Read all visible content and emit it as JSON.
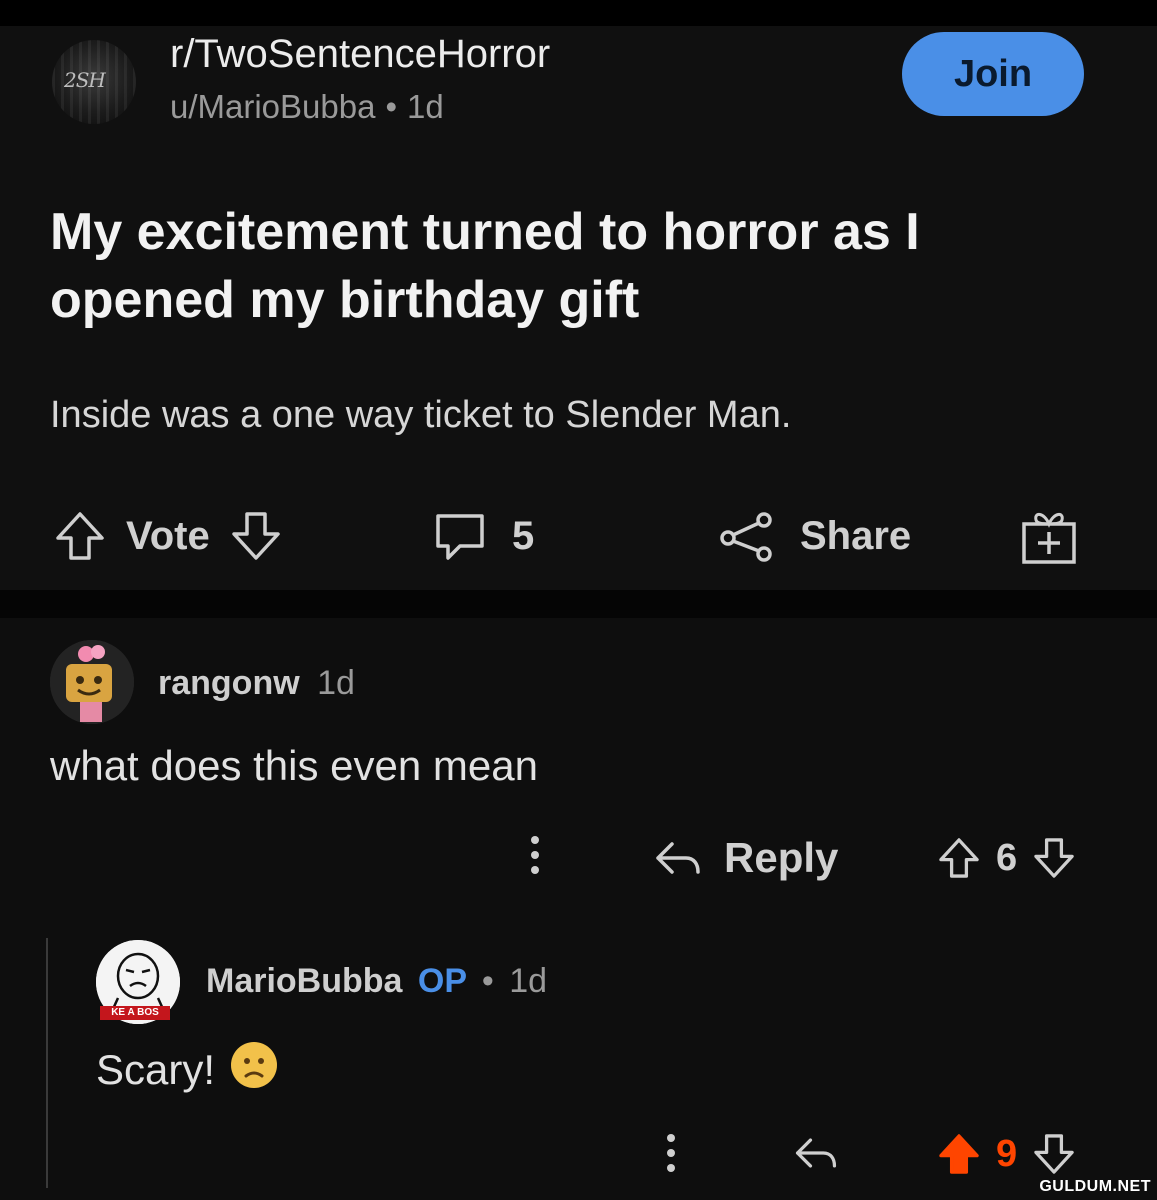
{
  "post": {
    "subreddit": "r/TwoSentenceHorror",
    "subreddit_icon_text": "2SH",
    "author": "u/MarioBubba",
    "age": "1d",
    "separator": "•",
    "join_label": "Join",
    "title": "My excitement turned to horror as I opened my birthday gift",
    "body": "Inside was a one way ticket to Slender Man.",
    "actions": {
      "vote_label": "Vote",
      "comment_count": "5",
      "share_label": "Share"
    }
  },
  "comments": [
    {
      "username": "rangonw",
      "age": "1d",
      "text": "what does this even mean",
      "reply_label": "Reply",
      "score": "6"
    },
    {
      "username": "MarioBubba",
      "op_badge": "OP",
      "separator": "•",
      "age": "1d",
      "text": "Scary!",
      "avatar_banner": "KE A BOS",
      "score": "9",
      "upvoted": true
    }
  ],
  "watermark": "GULDUM.NET",
  "colors": {
    "accent": "#4a8fe7",
    "upvote_active": "#ff4500",
    "background": "#0b0b0b"
  },
  "icons": [
    "upvote-icon",
    "downvote-icon",
    "comment-icon",
    "share-icon",
    "award-icon",
    "reply-icon",
    "more-options-icon",
    "worried-emoji-icon"
  ]
}
